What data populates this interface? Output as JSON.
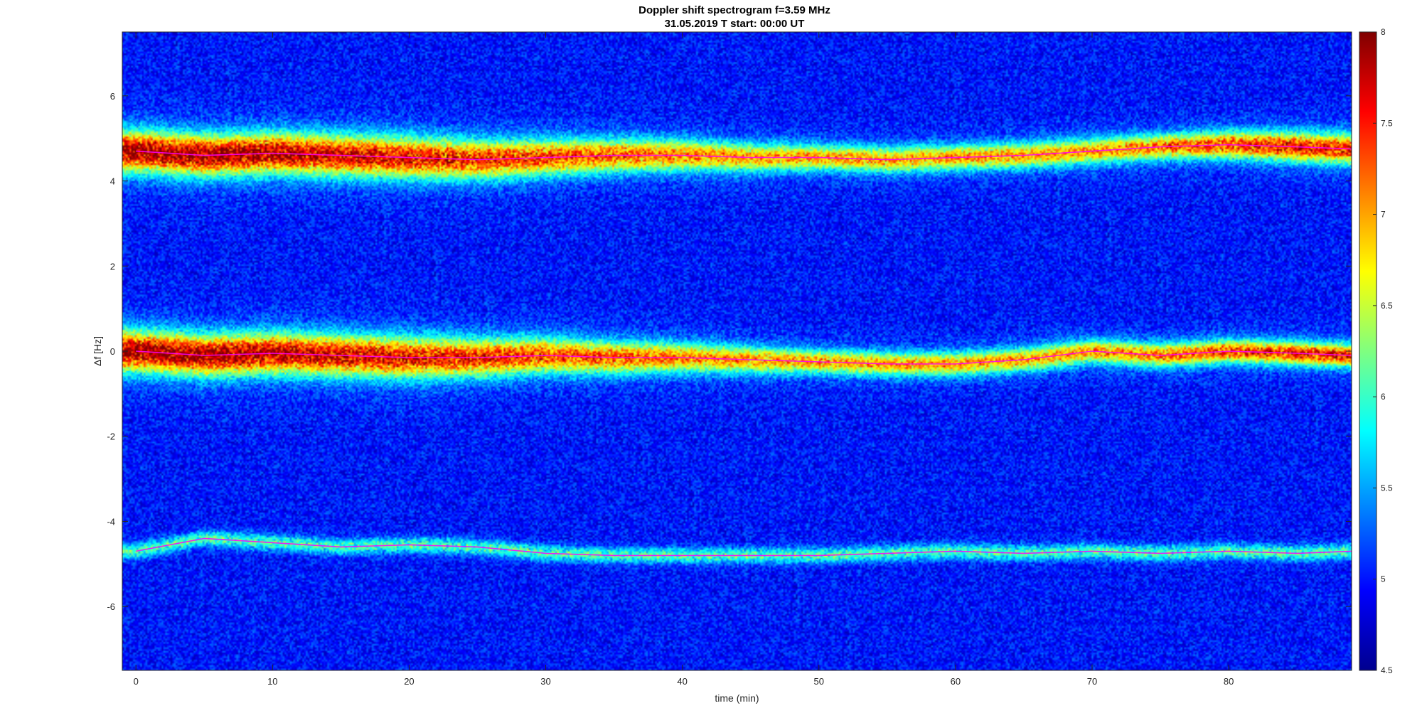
{
  "chart_data": {
    "type": "heatmap",
    "title": "Doppler shift spectrogram f=3.59 MHz",
    "subtitle": "31.05.2019    T start: 00:00 UT",
    "xlabel": "time (min)",
    "ylabel": "Δf [Hz]",
    "xlim": [
      -1,
      89
    ],
    "ylim": [
      -7.5,
      7.5
    ],
    "xticks": [
      0,
      10,
      20,
      30,
      40,
      50,
      60,
      70,
      80
    ],
    "xtick_labels": [
      "0",
      "10",
      "20",
      "30",
      "40",
      "50",
      "60",
      "70",
      "80"
    ],
    "yticks": [
      6,
      4,
      2,
      0,
      -2,
      -4,
      -6
    ],
    "ytick_labels": [
      "6",
      "4",
      "2",
      "0",
      "-2",
      "-4",
      "-6"
    ],
    "colormap": "jet",
    "colorbar": {
      "range": [
        4.5,
        8
      ],
      "ticks": [
        8,
        7.5,
        7,
        6.5,
        6,
        5.5,
        5,
        4.5
      ],
      "tick_labels": [
        "8",
        "7.5",
        "7",
        "6.5",
        "6",
        "5.5",
        "5",
        "4.5"
      ]
    },
    "grid": false,
    "series": [
      {
        "trace": "upper",
        "x": [
          0,
          5,
          10,
          15,
          20,
          25,
          30,
          35,
          40,
          45,
          50,
          55,
          60,
          65,
          70,
          75,
          80,
          85,
          89
        ],
        "y": [
          4.7,
          4.6,
          4.65,
          4.6,
          4.55,
          4.5,
          4.55,
          4.6,
          4.6,
          4.55,
          4.55,
          4.5,
          4.55,
          4.6,
          4.7,
          4.8,
          4.85,
          4.8,
          4.75
        ],
        "color": "#ff00ff"
      },
      {
        "trace": "middle",
        "x": [
          0,
          5,
          10,
          15,
          20,
          25,
          30,
          35,
          40,
          45,
          50,
          55,
          60,
          65,
          70,
          75,
          80,
          85,
          89
        ],
        "y": [
          0.0,
          -0.1,
          -0.05,
          -0.1,
          -0.15,
          -0.15,
          -0.1,
          -0.15,
          -0.15,
          -0.2,
          -0.25,
          -0.3,
          -0.3,
          -0.2,
          0.0,
          -0.1,
          0.0,
          -0.05,
          -0.1
        ],
        "color": "#ff00ff"
      },
      {
        "trace": "lower",
        "x": [
          0,
          5,
          10,
          15,
          20,
          25,
          30,
          35,
          40,
          45,
          50,
          55,
          60,
          65,
          70,
          75,
          80,
          85,
          89
        ],
        "y": [
          -4.7,
          -4.4,
          -4.5,
          -4.6,
          -4.55,
          -4.6,
          -4.75,
          -4.8,
          -4.8,
          -4.8,
          -4.8,
          -4.75,
          -4.7,
          -4.75,
          -4.7,
          -4.75,
          -4.7,
          -4.75,
          -4.7
        ],
        "color": "#ff00ff"
      }
    ]
  }
}
